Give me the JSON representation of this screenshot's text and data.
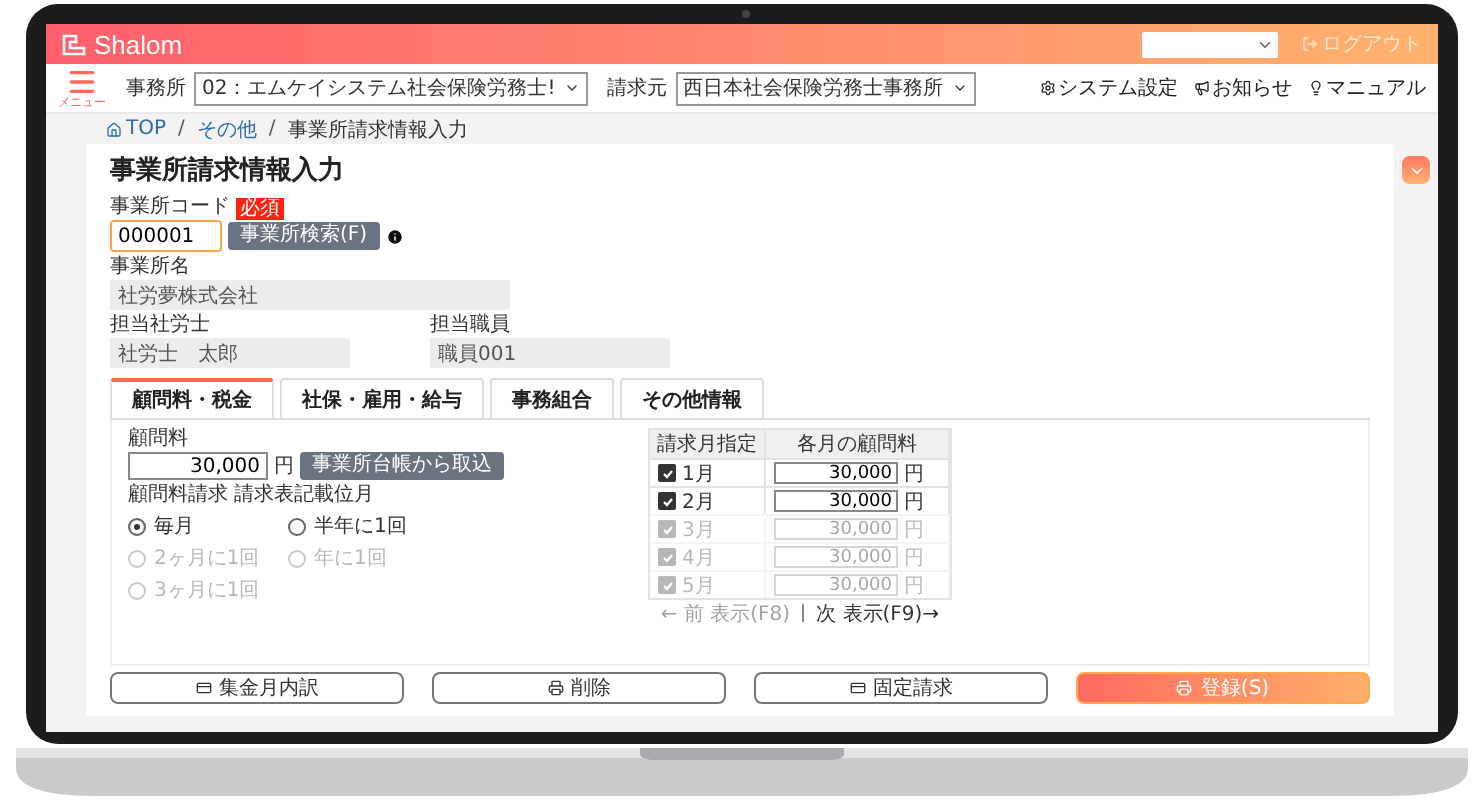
{
  "header": {
    "logo": "Shalom",
    "logout": "ログアウト"
  },
  "nav": {
    "menu": "メニュー",
    "office_label": "事務所",
    "office_value": "02：エムケイシステム社会保険労務士!",
    "billing_label": "請求元",
    "billing_value": "西日本社会保険労務士事務所",
    "links": [
      {
        "kind": "settings",
        "label": "システム設定"
      },
      {
        "kind": "notice",
        "label": "お知らせ"
      },
      {
        "kind": "manual",
        "label": "マニュアル"
      }
    ]
  },
  "breadcrumb": {
    "separator": "/",
    "items": [
      {
        "label": "TOP",
        "current": false
      },
      {
        "label": "その他",
        "current": false
      },
      {
        "label": "事業所請求情報入力",
        "current": true
      }
    ]
  },
  "title": "事業所請求情報入力",
  "office_code": {
    "label": "事業所コード",
    "badge": "必須",
    "value": "000001",
    "button": "事業所検索(F)"
  },
  "office_name": {
    "label": "事業所名",
    "value": "社労夢株式会社"
  },
  "staff": [
    {
      "label": "担当社労士",
      "value": "社労士　太郎"
    },
    {
      "label": "担当職員",
      "value": "職員001"
    }
  ],
  "tabs": [
    {
      "label": "顧問料・税金",
      "selected": true
    },
    {
      "label": "社保・雇用・給与",
      "selected": false
    },
    {
      "label": "事務組合",
      "selected": false
    },
    {
      "label": "その他情報",
      "selected": false
    }
  ],
  "fee": {
    "label": "顧問料",
    "value": "30,000",
    "unit": "円",
    "button": "事業所台帳から取込"
  },
  "billing": {
    "label": "顧問料請求",
    "sublabel": "請求表記載位月",
    "options": [
      {
        "label": "毎月",
        "selected": true,
        "faded": false
      },
      {
        "label": "半年に1回",
        "selected": false,
        "faded": false
      },
      {
        "label": "2ヶ月に1回",
        "selected": false,
        "faded": true
      },
      {
        "label": "年に1回",
        "selected": false,
        "faded": true
      },
      {
        "label": "3ヶ月に1回",
        "selected": false,
        "faded": true
      }
    ]
  },
  "months": {
    "columns": [
      "請求月指定",
      "各月の顧問料"
    ],
    "rows": [
      {
        "month": "1月",
        "checked": true,
        "value": "30,000",
        "unit": "円",
        "faded": false
      },
      {
        "month": "2月",
        "checked": true,
        "value": "30,000",
        "unit": "円",
        "faded": false
      },
      {
        "month": "3月",
        "checked": true,
        "value": "30,000",
        "unit": "円",
        "faded": true
      },
      {
        "month": "4月",
        "checked": true,
        "value": "30,000",
        "unit": "円",
        "faded": true
      },
      {
        "month": "5月",
        "checked": true,
        "value": "30,000",
        "unit": "円",
        "faded": true
      }
    ]
  },
  "pager": {
    "prev": "← 前 表示(F8)",
    "next": "次 表示(F9)→"
  },
  "actions": [
    {
      "kind": "card",
      "label": "集金月内訳",
      "primary": false
    },
    {
      "kind": "print",
      "label": "削除",
      "primary": false
    },
    {
      "kind": "card",
      "label": "固定請求",
      "primary": false
    },
    {
      "kind": "print",
      "label": "登録(S)",
      "primary": true
    }
  ]
}
